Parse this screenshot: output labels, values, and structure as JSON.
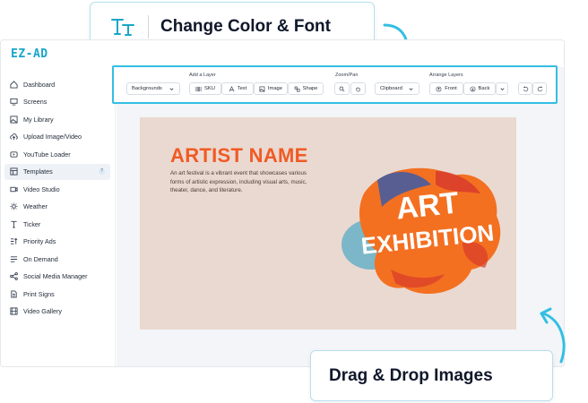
{
  "callouts": {
    "top": "Change Color & Font",
    "bottom": "Drag & Drop Images"
  },
  "app": {
    "logo": "EZ-AD",
    "accent": "#1aa6c9",
    "highlight": "#33bfe3"
  },
  "sidebar": {
    "items": [
      {
        "label": "Dashboard",
        "icon": "home-icon"
      },
      {
        "label": "Screens",
        "icon": "monitor-icon"
      },
      {
        "label": "My Library",
        "icon": "image-icon"
      },
      {
        "label": "Upload Image/Video",
        "icon": "upload-cloud-icon"
      },
      {
        "label": "YouTube Loader",
        "icon": "youtube-icon"
      },
      {
        "label": "Templates",
        "icon": "templates-icon",
        "active": true,
        "badge": "?"
      },
      {
        "label": "Video Studio",
        "icon": "video-icon"
      },
      {
        "label": "Weather",
        "icon": "sun-icon"
      },
      {
        "label": "Ticker",
        "icon": "text-icon"
      },
      {
        "label": "Priority Ads",
        "icon": "priority-icon"
      },
      {
        "label": "On Demand",
        "icon": "list-icon"
      },
      {
        "label": "Social Media Manager",
        "icon": "share-icon"
      },
      {
        "label": "Print Signs",
        "icon": "doc-icon"
      },
      {
        "label": "Video Gallery",
        "icon": "film-icon"
      }
    ]
  },
  "toolbar": {
    "backgrounds": "Backgrounds",
    "add_layer_title": "Add a Layer",
    "sku": "SKU",
    "text": "Text",
    "image": "Image",
    "shape": "Shape",
    "zoom_title": "Zoom/Pan",
    "clipboard": "Clipboard",
    "arrange_title": "Arrange Layers",
    "front": "Front",
    "back": "Back"
  },
  "canvas": {
    "title": "ARTIST NAME",
    "description": "An art festival is a vibrant event that showcases various forms of artistic expression, including visual arts, music, theater, dance, and literature.",
    "graphic_line1": "ART",
    "graphic_line2": "EXHIBITION",
    "bg": "#ead9d1",
    "title_color": "#f15a24"
  }
}
